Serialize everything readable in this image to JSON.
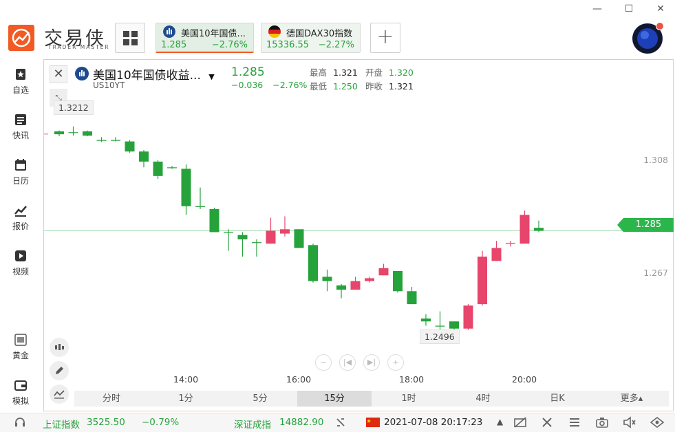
{
  "window": {
    "minimize": "—",
    "maximize": "☐",
    "close": "✕"
  },
  "brand": {
    "cn": "交易侠",
    "en": "TRADER MASTER"
  },
  "tabs": [
    {
      "name": "美国10年国债...",
      "price": "1.285",
      "change": "−2.76%"
    },
    {
      "name": "德国DAX30指数",
      "price": "15336.55",
      "change": "−2.27%"
    }
  ],
  "add_tab": "+",
  "sidebar": [
    {
      "label": "自选",
      "icon": "bookmark-icon"
    },
    {
      "label": "快讯",
      "icon": "news-icon"
    },
    {
      "label": "日历",
      "icon": "calendar-icon"
    },
    {
      "label": "报价",
      "icon": "quote-chart-icon"
    },
    {
      "label": "视频",
      "icon": "video-icon"
    },
    {
      "label": "黄金",
      "icon": "gold-icon"
    },
    {
      "label": "模拟",
      "icon": "wallet-icon"
    }
  ],
  "quote": {
    "name": "美国10年国债收益...",
    "code": "US10YT",
    "price": "1.285",
    "change": "−0.036",
    "change_pct": "−2.76%",
    "high_label": "最高",
    "high": "1.321",
    "low_label": "最低",
    "low": "1.250",
    "open_label": "开盘",
    "open": "1.320",
    "prev_label": "昨收",
    "prev": "1.321",
    "current_tag": "1.285",
    "high_marker": "1.3212",
    "low_marker": "1.2496"
  },
  "nav_controls": {
    "zoom_out": "−",
    "prev": "|◀",
    "next": "▶|",
    "zoom_in": "+"
  },
  "timeframes": [
    "分时",
    "1分",
    "5分",
    "15分",
    "1时",
    "4时",
    "日K",
    "更多▴"
  ],
  "active_timeframe": "15分",
  "status": {
    "sh_label": "上证指数",
    "sh_value": "3525.50",
    "sh_change": "−0.79%",
    "sz_label": "深证成指",
    "sz_value": "14882.90",
    "datetime": "2021-07-08 20:17:23"
  },
  "colors": {
    "up": "#e7456b",
    "down": "#26a23b",
    "accent": "#f15a24"
  },
  "chart_data": {
    "type": "candlestick",
    "ylim": [
      1.244,
      1.33
    ],
    "y_ticks": [
      "1.308",
      "1.267"
    ],
    "y_tick_values": [
      1.308,
      1.267
    ],
    "x_ticks": [
      "14:00",
      "16:00",
      "18:00",
      "20:00"
    ],
    "x_tick_index": [
      9.5,
      17.5,
      25.5,
      33.5
    ],
    "candles": [
      {
        "o": 1.3195,
        "c": 1.3185,
        "h": 1.3198,
        "l": 1.3178
      },
      {
        "o": 1.3192,
        "c": 1.319,
        "h": 1.3212,
        "l": 1.318
      },
      {
        "o": 1.3195,
        "c": 1.318,
        "h": 1.3198,
        "l": 1.3178
      },
      {
        "o": 1.3165,
        "c": 1.3163,
        "h": 1.3175,
        "l": 1.3158
      },
      {
        "o": 1.3165,
        "c": 1.3163,
        "h": 1.3175,
        "l": 1.316
      },
      {
        "o": 1.316,
        "c": 1.3125,
        "h": 1.3165,
        "l": 1.312
      },
      {
        "o": 1.3125,
        "c": 1.309,
        "h": 1.313,
        "l": 1.307
      },
      {
        "o": 1.309,
        "c": 1.304,
        "h": 1.3095,
        "l": 1.303
      },
      {
        "o": 1.307,
        "c": 1.3068,
        "h": 1.3075,
        "l": 1.3065
      },
      {
        "o": 1.3065,
        "c": 1.2935,
        "h": 1.308,
        "l": 1.2905
      },
      {
        "o": 1.2935,
        "c": 1.2932,
        "h": 1.3,
        "l": 1.2925
      },
      {
        "o": 1.2925,
        "c": 1.2845,
        "h": 1.293,
        "l": 1.2845
      },
      {
        "o": 1.2845,
        "c": 1.2843,
        "h": 1.2855,
        "l": 1.278
      },
      {
        "o": 1.2835,
        "c": 1.282,
        "h": 1.2845,
        "l": 1.276
      },
      {
        "o": 1.281,
        "c": 1.2808,
        "h": 1.282,
        "l": 1.276
      },
      {
        "o": 1.2805,
        "c": 1.285,
        "h": 1.2895,
        "l": 1.2805
      },
      {
        "o": 1.284,
        "c": 1.2855,
        "h": 1.29,
        "l": 1.283
      },
      {
        "o": 1.2855,
        "c": 1.279,
        "h": 1.2855,
        "l": 1.279
      },
      {
        "o": 1.28,
        "c": 1.2675,
        "h": 1.2805,
        "l": 1.267
      },
      {
        "o": 1.269,
        "c": 1.2675,
        "h": 1.2715,
        "l": 1.264
      },
      {
        "o": 1.266,
        "c": 1.2645,
        "h": 1.2665,
        "l": 1.2615
      },
      {
        "o": 1.2645,
        "c": 1.2675,
        "h": 1.269,
        "l": 1.2645
      },
      {
        "o": 1.2675,
        "c": 1.2685,
        "h": 1.269,
        "l": 1.267
      },
      {
        "o": 1.2695,
        "c": 1.272,
        "h": 1.2735,
        "l": 1.2695
      },
      {
        "o": 1.271,
        "c": 1.264,
        "h": 1.271,
        "l": 1.2635
      },
      {
        "o": 1.264,
        "c": 1.2595,
        "h": 1.2655,
        "l": 1.2595
      },
      {
        "o": 1.2545,
        "c": 1.2535,
        "h": 1.256,
        "l": 1.252
      },
      {
        "o": 1.252,
        "c": 1.2518,
        "h": 1.257,
        "l": 1.2496
      },
      {
        "o": 1.2535,
        "c": 1.251,
        "h": 1.2535,
        "l": 1.25
      },
      {
        "o": 1.251,
        "c": 1.259,
        "h": 1.2595,
        "l": 1.2505
      },
      {
        "o": 1.2595,
        "c": 1.276,
        "h": 1.278,
        "l": 1.259
      },
      {
        "o": 1.2745,
        "c": 1.279,
        "h": 1.2815,
        "l": 1.2745
      },
      {
        "o": 1.2805,
        "c": 1.2808,
        "h": 1.2815,
        "l": 1.2795
      },
      {
        "o": 1.2805,
        "c": 1.2905,
        "h": 1.292,
        "l": 1.2805
      },
      {
        "o": 1.286,
        "c": 1.285,
        "h": 1.2885,
        "l": 1.2845
      }
    ],
    "current_price": 1.285
  }
}
